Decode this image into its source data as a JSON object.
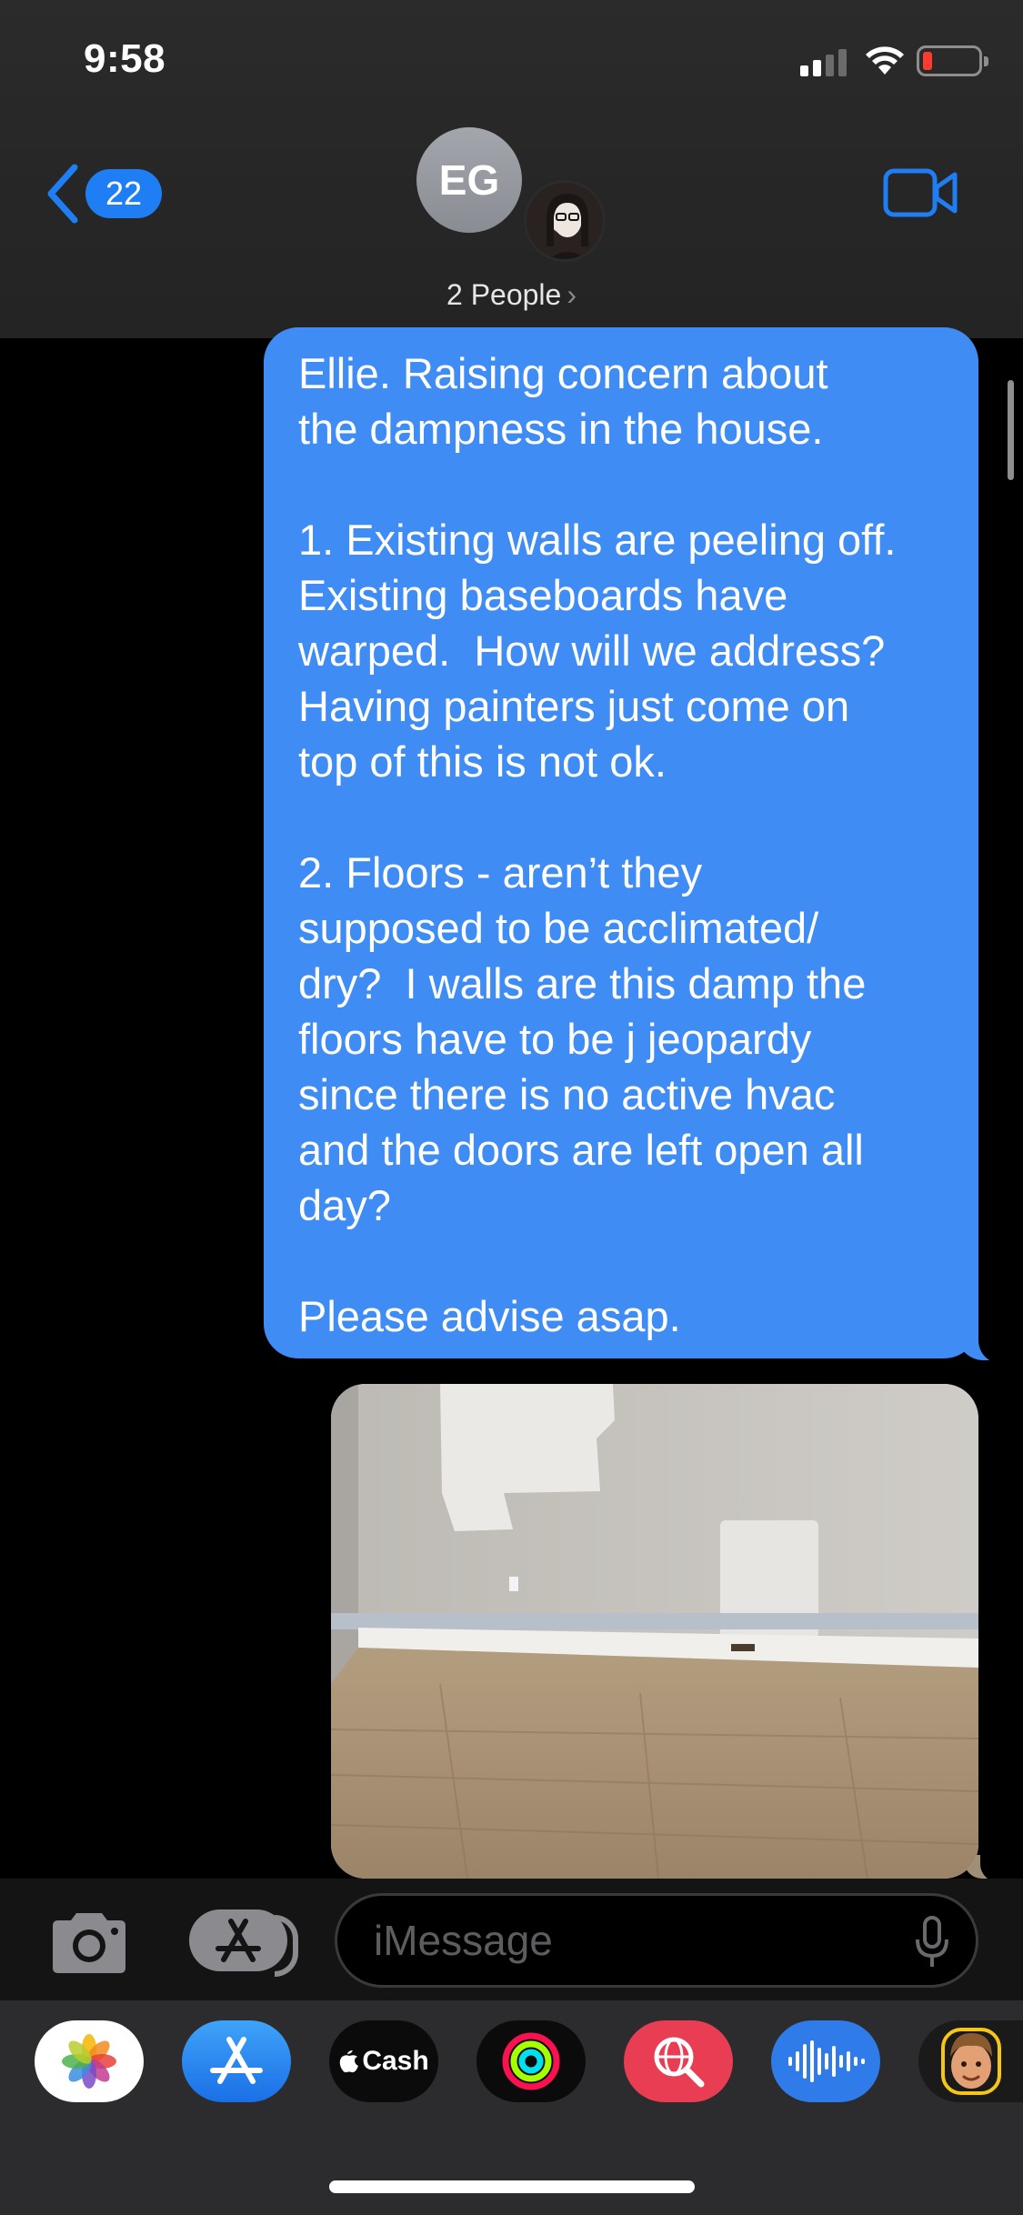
{
  "status_bar": {
    "time": "9:58"
  },
  "header": {
    "back_count": "22",
    "group_initials": "EG",
    "participants_label": "2 People",
    "chevron": "›"
  },
  "message": {
    "text": "Ellie. Raising concern about\nthe dampness in the house.\n\n1. Existing walls are peeling off.\nExisting baseboards have\nwarped.  How will we address?\nHaving painters just come on\ntop of this is not ok.\n\n2. Floors - aren’t they\nsupposed to be acclimated/\ndry?  I walls are this damp the\nfloors have to be j jeopardy\nsince there is no active hvac\nand the doors are left open all\nday?\n\nPlease advise asap."
  },
  "composer": {
    "placeholder": "iMessage"
  },
  "app_drawer": {
    "cash_label": "Cash"
  },
  "icons": [
    "back-chevron-icon",
    "video-call-icon",
    "camera-icon",
    "app-store-icon",
    "microphone-icon",
    "photos-icon",
    "apple-cash-icon",
    "activity-icon",
    "web-images-icon",
    "audio-message-icon",
    "memoji-icon"
  ],
  "colors": {
    "bubble": "#3f8cf5",
    "accent": "#1f7ef4",
    "battery_low": "#ff3b30"
  }
}
